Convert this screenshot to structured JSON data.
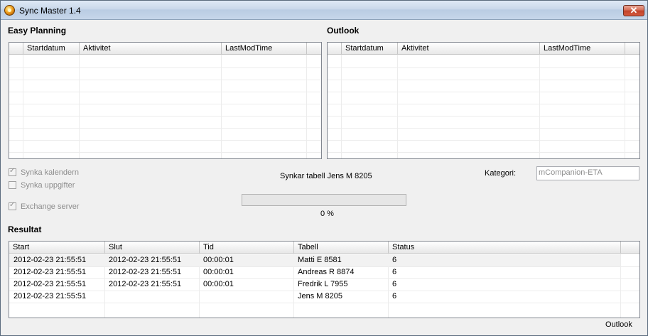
{
  "window": {
    "title": "Sync Master 1.4",
    "close_label": "✕"
  },
  "easy_planning": {
    "title": "Easy Planning",
    "columns": [
      "",
      "Startdatum",
      "Aktivitet",
      "LastModTime",
      ""
    ]
  },
  "outlook_panel": {
    "title": "Outlook",
    "columns": [
      "",
      "Startdatum",
      "Aktivitet",
      "LastModTime",
      ""
    ]
  },
  "options": {
    "synka_kalendern": {
      "label": "Synka kalendern",
      "checked": true
    },
    "synka_uppgifter": {
      "label": "Synka uppgifter",
      "checked": false
    },
    "exchange_server": {
      "label": "Exchange server",
      "checked": true
    }
  },
  "sync_status": "Synkar tabell Jens M 8205",
  "progress": {
    "value": 0,
    "label": "0 %"
  },
  "kategori": {
    "label": "Kategori:",
    "value": "mCompanion-ETA"
  },
  "resultat": {
    "title": "Resultat",
    "columns": [
      "Start",
      "Slut",
      "Tid",
      "Tabell",
      "Status",
      ""
    ],
    "rows": [
      [
        "2012-02-23 21:55:51",
        "2012-02-23 21:55:51",
        "00:00:01",
        "Matti E 8581",
        "6"
      ],
      [
        "2012-02-23 21:55:51",
        "2012-02-23 21:55:51",
        "00:00:01",
        "Andreas R 8874",
        "6"
      ],
      [
        "2012-02-23 21:55:51",
        "2012-02-23 21:55:51",
        "00:00:01",
        "Fredrik L 7955",
        "6"
      ],
      [
        "2012-02-23 21:55:51",
        "",
        "",
        "Jens M 8205",
        "6"
      ]
    ]
  },
  "footer": {
    "status_right": "Outlook"
  }
}
